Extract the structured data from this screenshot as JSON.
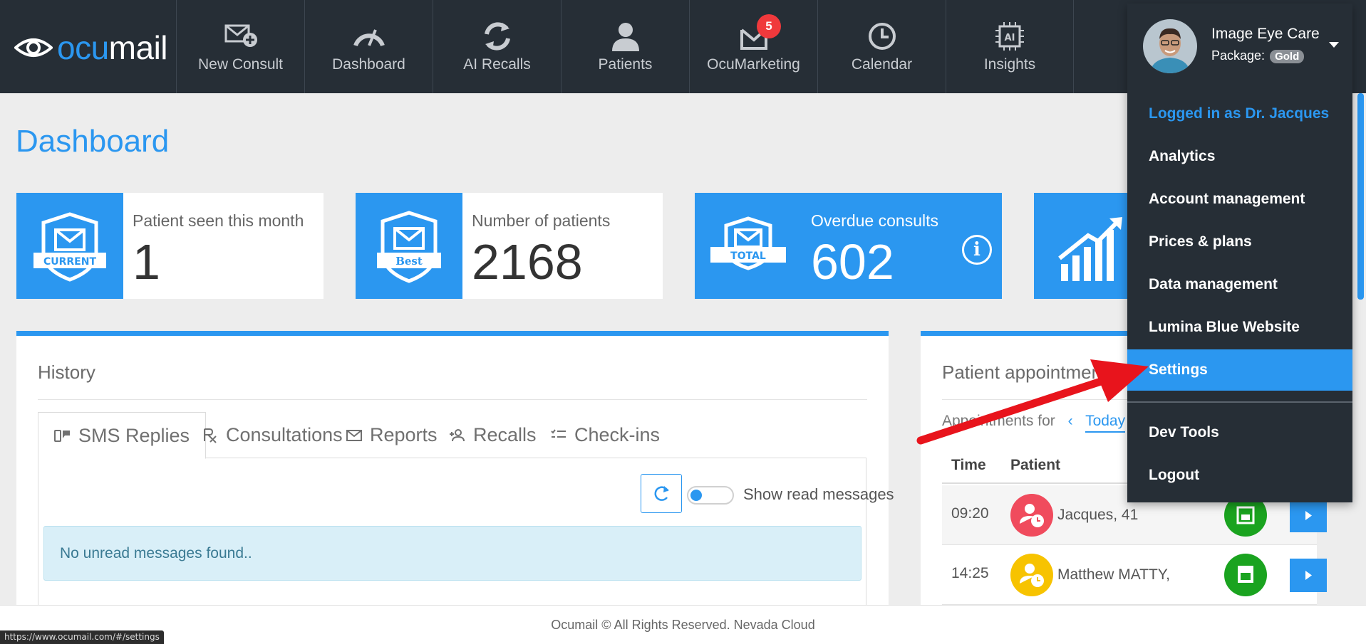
{
  "brand": {
    "logo_text_1": "ocu",
    "logo_text_2": "mail"
  },
  "nav": {
    "items": [
      {
        "label": "New Consult",
        "icon": "new-consult-icon"
      },
      {
        "label": "Dashboard",
        "icon": "speedometer-icon"
      },
      {
        "label": "AI Recalls",
        "icon": "refresh-icon"
      },
      {
        "label": "Patients",
        "icon": "person-icon"
      },
      {
        "label": "OcuMarketing",
        "icon": "marketing-mail-icon",
        "badge": "5"
      },
      {
        "label": "Calendar",
        "icon": "clock-icon"
      },
      {
        "label": "Insights",
        "icon": "ai-chip-icon"
      }
    ]
  },
  "page": {
    "title": "Dashboard"
  },
  "stats": [
    {
      "label": "Patient seen this month",
      "value": "1",
      "badge_text": "CURRENT"
    },
    {
      "label": "Number of patients",
      "value": "2168",
      "badge_text": "Best"
    },
    {
      "label": "Overdue consults",
      "value": "602",
      "badge_text": "TOTAL",
      "info": "i"
    }
  ],
  "history": {
    "title": "History",
    "tabs": [
      {
        "label": "SMS Replies",
        "icon": "sms-icon",
        "active": true
      },
      {
        "label": "Consultations",
        "icon": "prescription-icon"
      },
      {
        "label": "Reports",
        "icon": "envelope-icon"
      },
      {
        "label": "Recalls",
        "icon": "person-add-icon"
      },
      {
        "label": "Check-ins",
        "icon": "checklist-icon"
      }
    ],
    "toggle_label": "Show read messages",
    "empty_message": "No unread messages found.."
  },
  "appointments": {
    "title": "Patient appointmen",
    "for_label": "Appointments for",
    "chevron": "‹",
    "selected_day": "Today",
    "columns": [
      "Time",
      "Patient"
    ],
    "rows": [
      {
        "time": "09:20",
        "patient": "Jacques, 41",
        "status_color": "#f04b5d"
      },
      {
        "time": "14:25",
        "patient": "Matthew MATTY,",
        "status_color": "#f7c300"
      }
    ]
  },
  "footer": {
    "text": "Ocumail © All Rights Reserved. Nevada Cloud"
  },
  "statusbar": {
    "url": "https://www.ocumail.com/#/settings"
  },
  "user_menu": {
    "name": "Image Eye Care",
    "package_label": "Package:",
    "package": "Gold",
    "logged_in_as": "Logged in as Dr. Jacques",
    "items": [
      "Analytics",
      "Account management",
      "Prices & plans",
      "Data management",
      "Lumina Blue Website",
      "Settings",
      "Dev Tools",
      "Logout"
    ],
    "active_item": "Settings"
  },
  "colors": {
    "brand_blue": "#2b97f0",
    "nav_bg": "#262e36",
    "badge_red": "#f0393c",
    "annotation_red": "#e8141c",
    "calendar_green": "#1aa31f"
  }
}
